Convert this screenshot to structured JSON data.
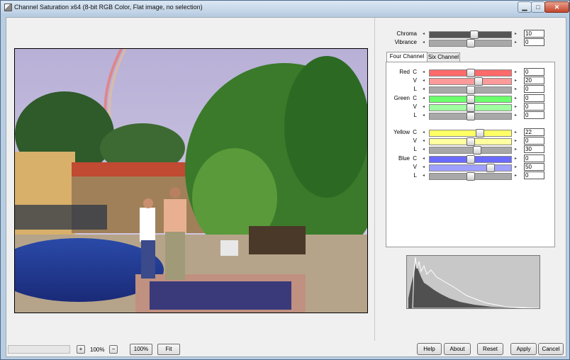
{
  "window": {
    "title": "Channel Saturation x64 (8-bit RGB Color, Flat image, no selection)",
    "controls": {
      "minimize": "▁",
      "maximize": "□",
      "close": "✕"
    }
  },
  "global": {
    "chroma": {
      "label": "Chroma",
      "value": "10"
    },
    "vibrance": {
      "label": "Vibrance",
      "value": "0"
    }
  },
  "tabs": [
    {
      "label": "Four Channel",
      "active": true
    },
    {
      "label": "Six Channel",
      "active": false
    }
  ],
  "channels": [
    {
      "name": "Red",
      "rows": [
        {
          "label": "C",
          "value": "0"
        },
        {
          "label": "V",
          "value": "20"
        },
        {
          "label": "L",
          "value": "0"
        }
      ]
    },
    {
      "name": "Green",
      "rows": [
        {
          "label": "C",
          "value": "0"
        },
        {
          "label": "V",
          "value": "0"
        },
        {
          "label": "L",
          "value": "0"
        }
      ]
    },
    {
      "name": "Yellow",
      "rows": [
        {
          "label": "C",
          "value": "22"
        },
        {
          "label": "V",
          "value": "0"
        },
        {
          "label": "L",
          "value": "30"
        }
      ]
    },
    {
      "name": "Blue",
      "rows": [
        {
          "label": "C",
          "value": "0"
        },
        {
          "label": "V",
          "value": "50"
        },
        {
          "label": "L",
          "value": "0"
        }
      ]
    }
  ],
  "zoom": {
    "plus": "+",
    "level": "100%",
    "minus": "−",
    "reset_label": "100%",
    "fit_label": "Fit"
  },
  "buttons": {
    "help": "Help",
    "about": "About",
    "reset": "Reset",
    "apply": "Apply",
    "cancel": "Cancel"
  },
  "colors": {
    "red": "#ff6a6a",
    "green": "#6cff6c",
    "yellow": "#ffff66",
    "blue": "#6a6aff",
    "gray": "#a8a8a8",
    "dark": "#505050"
  }
}
